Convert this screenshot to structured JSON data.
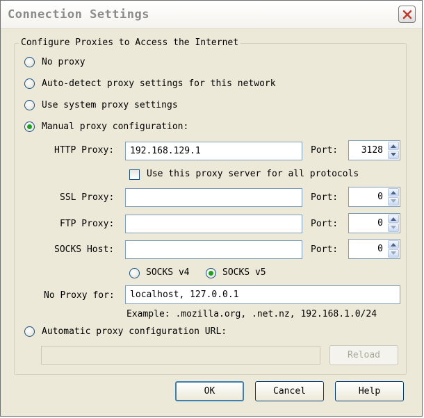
{
  "window": {
    "title": "Connection Settings"
  },
  "group": {
    "legend": "Configure Proxies to Access the Internet"
  },
  "radios": {
    "no_proxy": "No proxy",
    "auto_detect": "Auto-detect proxy settings for this network",
    "system": "Use system proxy settings",
    "manual": "Manual proxy configuration:",
    "auto_url": "Automatic proxy configuration URL:",
    "selected": "manual"
  },
  "http": {
    "label": "HTTP Proxy:",
    "value": "192.168.129.1",
    "port_label": "Port:",
    "port": "3128"
  },
  "use_all": {
    "label": "Use this proxy server for all protocols",
    "checked": false
  },
  "ssl": {
    "label": "SSL Proxy:",
    "value": "",
    "port_label": "Port:",
    "port": "0"
  },
  "ftp": {
    "label": "FTP Proxy:",
    "value": "",
    "port_label": "Port:",
    "port": "0"
  },
  "socks": {
    "label": "SOCKS Host:",
    "value": "",
    "port_label": "Port:",
    "port": "0"
  },
  "socks_version": {
    "v4": "SOCKS v4",
    "v5": "SOCKS v5",
    "selected": "v5"
  },
  "no_proxy_for": {
    "label": "No Proxy for:",
    "value": "localhost, 127.0.0.1",
    "example": "Example: .mozilla.org, .net.nz, 192.168.1.0/24"
  },
  "auto_url": {
    "value": "",
    "reload": "Reload"
  },
  "buttons": {
    "ok": "OK",
    "cancel": "Cancel",
    "help": "Help"
  },
  "colors": {
    "radio_dot": "#21a121",
    "dialog_bg": "#ece9d8",
    "title_text": "#8a8a8a",
    "close_x": "#c0392b"
  }
}
